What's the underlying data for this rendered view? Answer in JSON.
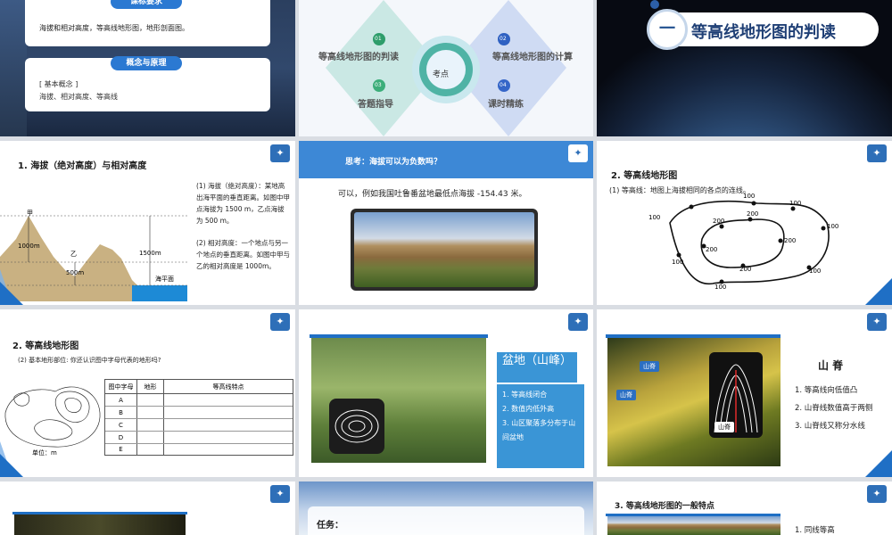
{
  "s1": {
    "banner1": "课标要求",
    "text1": "海拔和相对高度，等高线地形图，地形剖面图。",
    "banner2": "概念与原理",
    "text2a": "[ 基本概念 ]",
    "text2b": "海拔、相对高度、等高线"
  },
  "s2": {
    "center": "考点",
    "items": [
      {
        "num": "01",
        "label": "等高线地形图的判读"
      },
      {
        "num": "02",
        "label": "等高线地形图的计算"
      },
      {
        "num": "03",
        "label": "答题指导"
      },
      {
        "num": "04",
        "label": "课时精练"
      }
    ]
  },
  "s3": {
    "num": "一",
    "title": "等高线地形图的判读"
  },
  "s4": {
    "title": "1.  海拔（绝对高度）与相对高度",
    "p1": "(1) 海拔（绝对高度）：某地高出海平面的垂直距离。如图中甲点海拔为 1500 m，乙点海拔为 500 m。",
    "p2": "(2) 相对高度：一个地点与另一个地点的垂直距离。如图中甲与乙的相对高度是 1000m。",
    "labels": {
      "jia": "甲",
      "yi": "乙",
      "h1000": "1000m",
      "h1500": "1500m",
      "h500": "500m",
      "sea": "海平面"
    }
  },
  "s5": {
    "header": "思考：海拔可以为负数吗？",
    "text": "可以，例如我国吐鲁番盆地最低点海拔 -154.43 米。"
  },
  "s6": {
    "title": "2.  等高线地形图",
    "sub": "(1) 等高线：地图上海拔相同的各点的连线。",
    "outer": [
      "100",
      "100",
      "100",
      "100",
      "100",
      "100",
      "100"
    ],
    "inner": [
      "200",
      "200",
      "200",
      "200",
      "200"
    ]
  },
  "s7": {
    "title": "2.  等高线地形图",
    "sub": "(2) 基本地形部位:   你还认识图中字母代表的地形吗?",
    "unit": "单位：m",
    "table_headers": [
      "图中字母",
      "地形",
      "等高线特点"
    ],
    "rows": [
      "A",
      "B",
      "C",
      "D",
      "E"
    ]
  },
  "s8": {
    "title": "盆地（山峰）",
    "items": [
      "1.  等高线闭合",
      "2.  数值内低外高",
      "3.  山区聚落多分布于山间盆地"
    ]
  },
  "s9": {
    "title": "山 脊",
    "tag1": "山脊",
    "tag2": "山脊",
    "tag3": "山脊",
    "items": [
      "1. 等高线向低值凸",
      "2. 山脊线数值高于两侧",
      "3. 山脊线又称分水线"
    ]
  },
  "s11": {
    "task": "任务："
  },
  "s12": {
    "title": "3. 等高线地形图的一般特点",
    "item": "1. 同线等高"
  }
}
